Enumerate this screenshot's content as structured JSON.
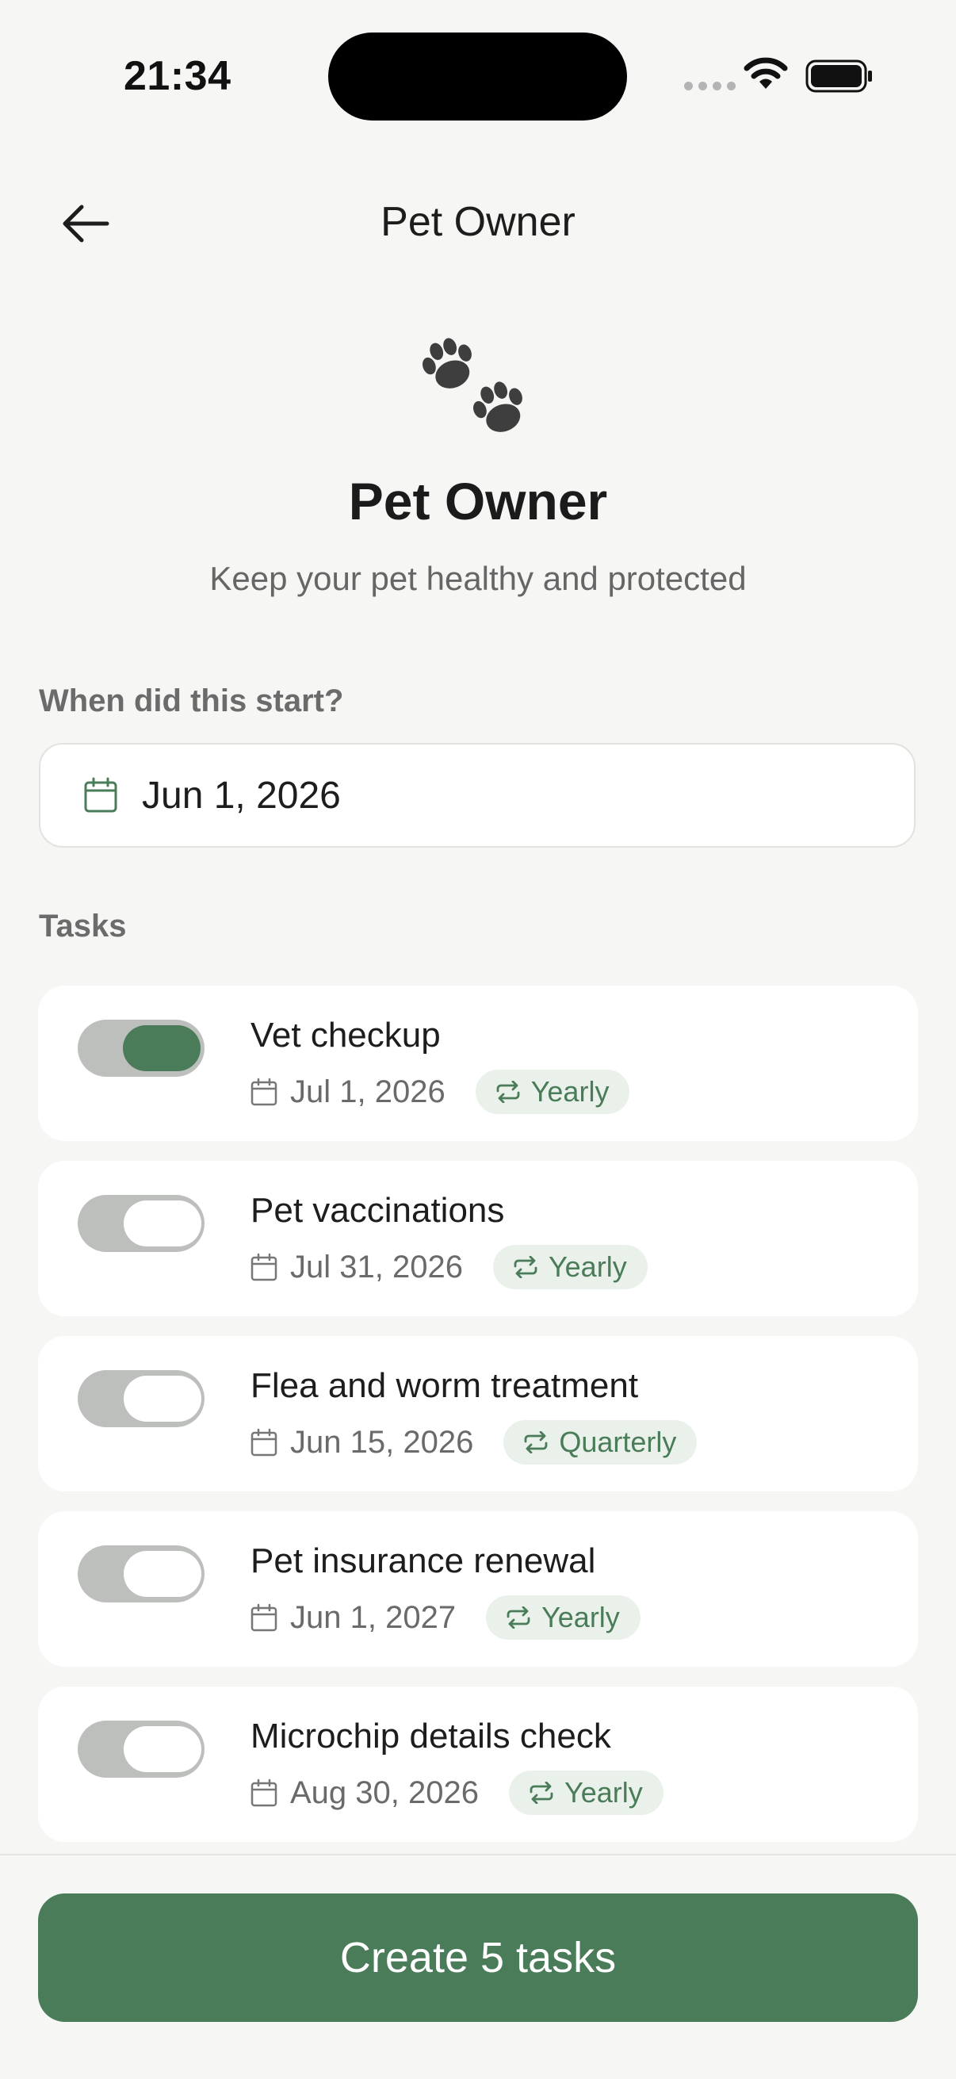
{
  "status_bar": {
    "time": "21:34"
  },
  "header": {
    "title": "Pet Owner",
    "back_icon": "arrow-left-icon"
  },
  "hero": {
    "icon": "paw-prints-icon",
    "title": "Pet Owner",
    "subtitle": "Keep your pet healthy and protected"
  },
  "start_section": {
    "label": "When did this start?",
    "date_value": "Jun 1, 2026",
    "icon": "calendar-icon"
  },
  "tasks_section": {
    "label": "Tasks",
    "items": [
      {
        "title": "Vet checkup",
        "date": "Jul 1, 2026",
        "frequency": "Yearly",
        "enabled": true
      },
      {
        "title": "Pet vaccinations",
        "date": "Jul 31, 2026",
        "frequency": "Yearly",
        "enabled": false
      },
      {
        "title": "Flea and worm treatment",
        "date": "Jun 15, 2026",
        "frequency": "Quarterly",
        "enabled": false
      },
      {
        "title": "Pet insurance renewal",
        "date": "Jun 1, 2027",
        "frequency": "Yearly",
        "enabled": false
      },
      {
        "title": "Microchip details check",
        "date": "Aug 30, 2026",
        "frequency": "Yearly",
        "enabled": false
      }
    ]
  },
  "footer": {
    "create_label": "Create 5 tasks"
  },
  "colors": {
    "accent": "#4a7c59",
    "badge_bg": "#eaf1ea",
    "toggle_track": "#bdbfbd",
    "background": "#f6f6f4"
  }
}
